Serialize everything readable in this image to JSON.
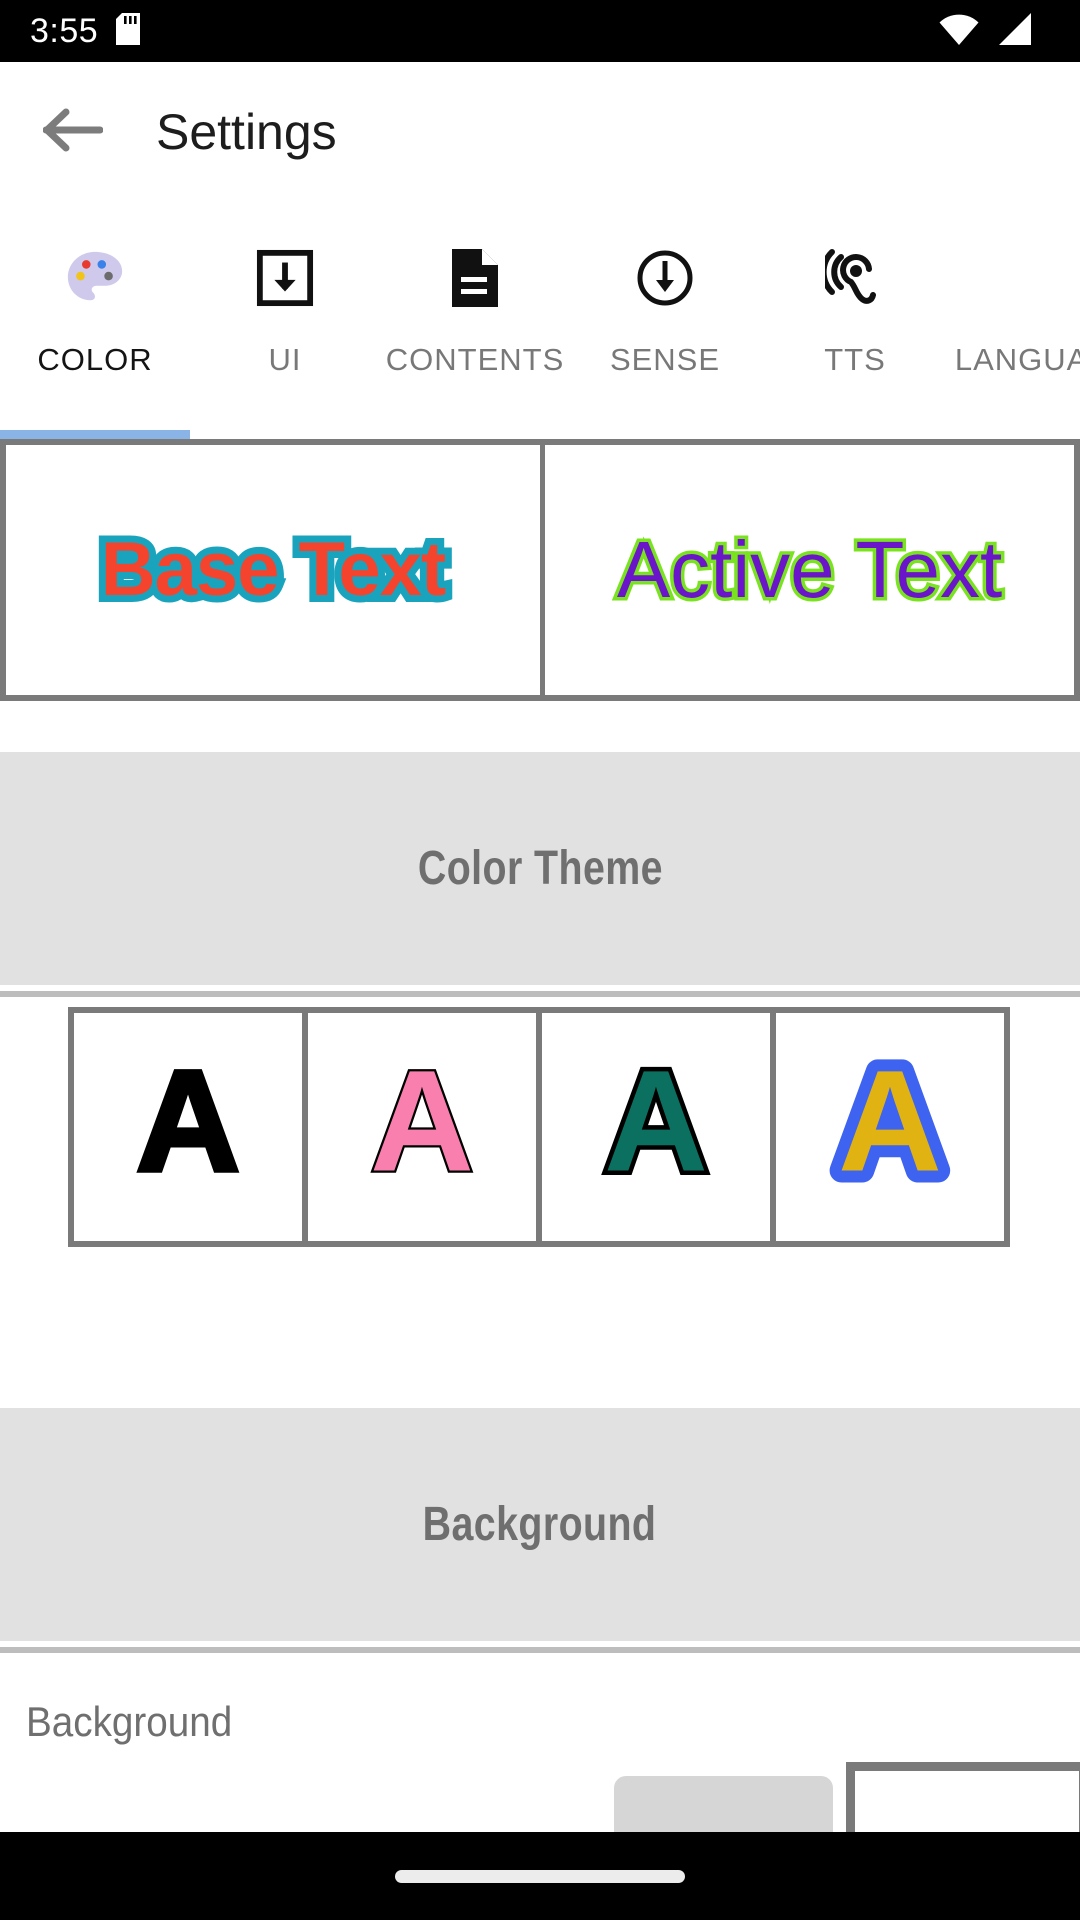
{
  "status_bar": {
    "time": "3:55",
    "sdcard_icon": "sdcard-icon",
    "wifi_icon": "wifi-icon",
    "signal_icon": "cellular-signal-icon"
  },
  "app_bar": {
    "back_icon": "back-arrow-icon",
    "title": "Settings"
  },
  "tabs": [
    {
      "label": "COLOR",
      "icon": "palette-icon",
      "active": true
    },
    {
      "label": "UI",
      "icon": "download-box-icon",
      "active": false
    },
    {
      "label": "CONTENTS",
      "icon": "document-icon",
      "active": false
    },
    {
      "label": "SENSE",
      "icon": "circle-arrow-down-icon",
      "active": false
    },
    {
      "label": "TTS",
      "icon": "ear-hearing-icon",
      "active": false
    },
    {
      "label": "LANGUAGE",
      "icon": "language-icon",
      "active": false
    }
  ],
  "preview": {
    "base": {
      "text": "Base Text",
      "fill_color": "#f4442e",
      "outline_color": "#1aa3bd"
    },
    "active": {
      "text": "Active Text",
      "fill_color": "#6a15c9",
      "outline_color": "#78e31e"
    }
  },
  "sections": {
    "color_theme": {
      "title": "Color Theme"
    },
    "background": {
      "title": "Background"
    }
  },
  "color_themes": [
    {
      "letter": "A",
      "fill_color": "#000000",
      "outline_color": "#000000",
      "name": "theme-black"
    },
    {
      "letter": "A",
      "fill_color": "#f97fae",
      "outline_color": "#000000",
      "name": "theme-pink"
    },
    {
      "letter": "A",
      "fill_color": "#0b7060",
      "outline_color": "#000000",
      "name": "theme-teal"
    },
    {
      "letter": "A",
      "fill_color": "#e0b312",
      "outline_color": "#3d63f0",
      "name": "theme-gold-blue"
    }
  ],
  "background_row": {
    "label": "Background",
    "swatch_gray_color": "#d6d6d6",
    "swatch_white_color": "#ffffff"
  },
  "nav_bar": {
    "home_indicator": "home-indicator"
  },
  "theme_colors": {
    "tab_indicator": "#8ab4e6",
    "band_background": "#e1e1e1",
    "frame_gray": "#7a7a7a"
  }
}
